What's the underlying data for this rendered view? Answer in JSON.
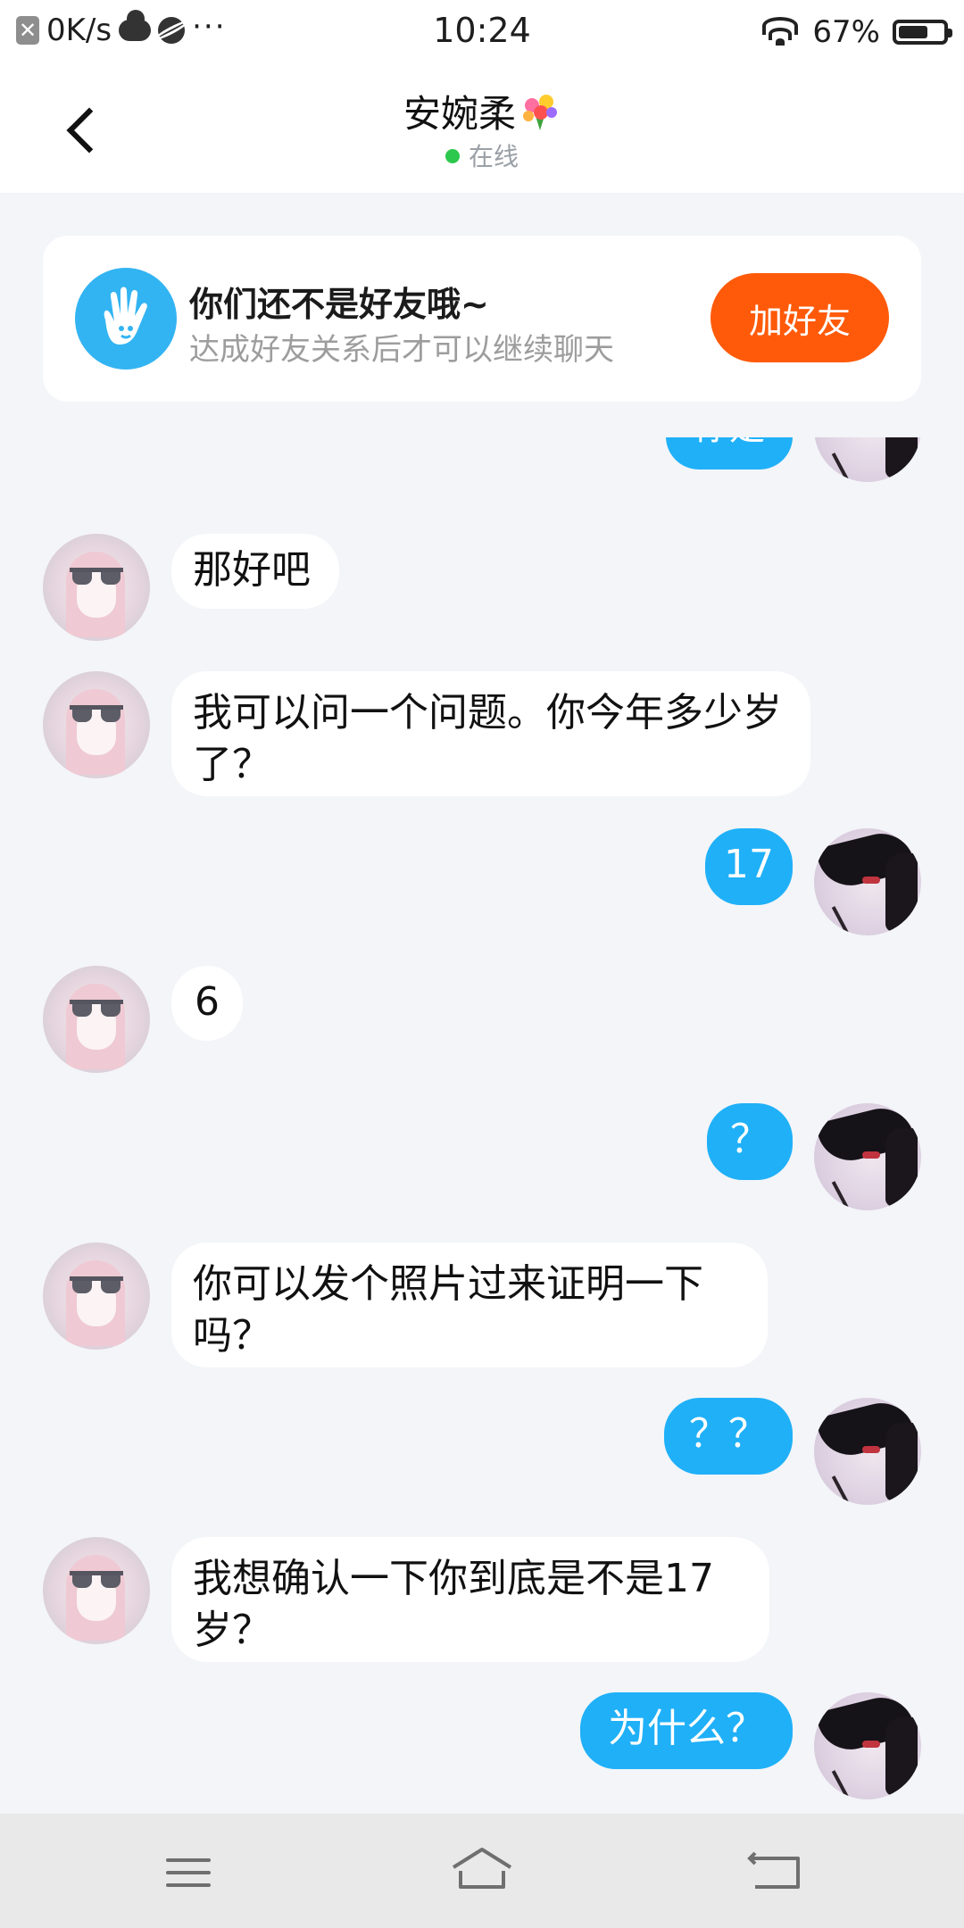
{
  "status_bar": {
    "net_speed": "0K/s",
    "time": "10:24",
    "battery_text": "67%",
    "battery_level": 0.67,
    "icons": [
      "app-notification-icon",
      "cloud-icon",
      "planet-icon",
      "more-dots-icon",
      "wifi-icon",
      "battery-icon"
    ]
  },
  "header": {
    "title": "安婉柔",
    "title_emoji": "💐",
    "status": "在线",
    "status_color": "#2cc84d"
  },
  "friend_card": {
    "title": "你们还不是好友哦~",
    "subtitle": "达成好友关系后才可以继续聊天",
    "button": "加好友",
    "button_color": "#ff5a0a",
    "icon_color": "#33b4f2"
  },
  "messages": [
    {
      "side": "out",
      "text": "你是",
      "partial": true
    },
    {
      "side": "in",
      "text": "那好吧"
    },
    {
      "side": "in",
      "text": "我可以问一个问题。你今年多少岁了？"
    },
    {
      "side": "out",
      "text": "17"
    },
    {
      "side": "in",
      "text": "6"
    },
    {
      "side": "out",
      "text": "？"
    },
    {
      "side": "in",
      "text": "你可以发个照片过来证明一下吗？"
    },
    {
      "side": "out",
      "text": "？？"
    },
    {
      "side": "in",
      "text": "我想确认一下你到底是不是17岁？"
    },
    {
      "side": "out",
      "text": "为什么？"
    }
  ],
  "colors": {
    "outgoing_bubble": "#1fb0f8",
    "incoming_bubble": "#ffffff",
    "chat_background": "#f3f5f8"
  },
  "nav_bar": {
    "icons": [
      "menu-icon",
      "home-icon",
      "back-icon"
    ]
  }
}
